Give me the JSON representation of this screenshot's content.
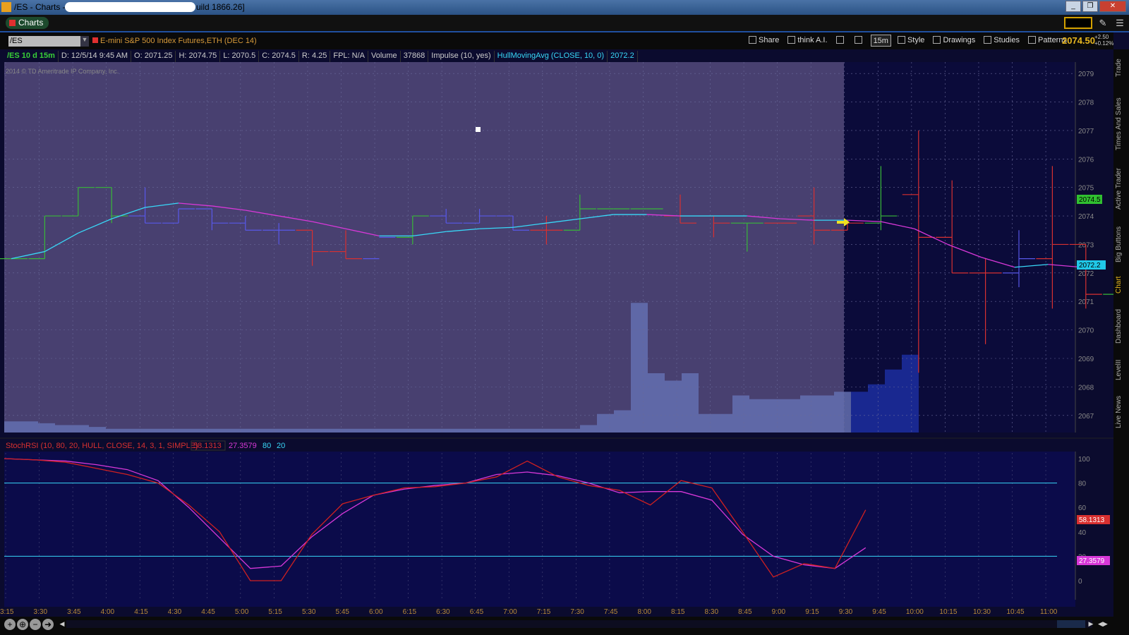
{
  "window": {
    "title": "/ES - Charts -",
    "build": "uild 1866.26]",
    "min": "_",
    "max": "❐",
    "close": "✕"
  },
  "tabbar": {
    "charts_label": "Charts",
    "pin": "✎",
    "menu": "☰"
  },
  "toolbar": {
    "symbol": "/ES",
    "dropdown": "▼",
    "description": "E-mini S&P 500 Index Futures,ETH (DEC 14)",
    "buttons": [
      {
        "label": "Share",
        "icon": "share-icon"
      },
      {
        "label": "think A.I.",
        "icon": "ai-icon"
      },
      {
        "label": "",
        "icon": "tools-icon"
      },
      {
        "label": "",
        "icon": "wrench-icon"
      },
      {
        "label": "15m",
        "icon": ""
      },
      {
        "label": "Style",
        "icon": "style-icon"
      },
      {
        "label": "Drawings",
        "icon": "pencil-icon"
      },
      {
        "label": "Studies",
        "icon": "studies-icon"
      },
      {
        "label": "Patterns",
        "icon": "patterns-icon"
      }
    ],
    "last": "2074.50",
    "chg": "+2.50",
    "pct": "+0.12%"
  },
  "infobar": {
    "ticker": "/ES 10 d 15m",
    "date": "D: 12/5/14 9:45 AM",
    "open": "O: 2071.25",
    "high": "H: 2074.75",
    "low": "L: 2070.5",
    "close": "C: 2074.5",
    "range": "R: 4.25",
    "fpl": "FPL: N/A",
    "volume_label": "Volume",
    "volume_value": "37868",
    "impulse": "Impulse (10, yes)",
    "hma": "HullMovingAvg (CLOSE, 10, 0)",
    "hma_value": "2072.2"
  },
  "copyright": "2014 © TD Ameritrade IP Company, Inc.",
  "lower": {
    "study": "StochRSI (10, 80, 20, HULL, CLOSE, 14, 3, 1, SIMPLE)",
    "k_value": "58.1313",
    "d_value": "27.3579",
    "ob": "80",
    "os": "20"
  },
  "price_tags": {
    "last": "2074.5",
    "hma": "2072.2",
    "k": "58.1313",
    "d": "27.3579"
  },
  "colors": {
    "up": "#38b838",
    "down": "#d83030",
    "flat": "#5858e8",
    "hma_up": "#38d8f8",
    "hma_down": "#d838d8",
    "bg": "#0b0b2e",
    "shade": "#484070"
  },
  "sidetabs": [
    "Trade",
    "Times And Sales",
    "Active Trader",
    "Big Buttons",
    "Chart",
    "Dashboard",
    "LevelII",
    "Live News"
  ],
  "nav": {
    "zoom_in": "+",
    "zoom_reset": "⊕",
    "zoom_out": "−",
    "forward": "➜"
  },
  "chart_data": {
    "type": "bar",
    "time_labels": [
      "3:15",
      "3:30",
      "3:45",
      "4:00",
      "4:15",
      "4:30",
      "4:45",
      "5:00",
      "5:15",
      "5:30",
      "5:45",
      "6:00",
      "6:15",
      "6:30",
      "6:45",
      "7:00",
      "7:15",
      "7:30",
      "7:45",
      "8:00",
      "8:15",
      "8:30",
      "8:45",
      "9:00",
      "9:15",
      "9:30",
      "9:45",
      "10:00",
      "10:15",
      "10:30",
      "10:45",
      "11:00"
    ],
    "price_ticks": [
      2067,
      2068,
      2069,
      2070,
      2071,
      2072,
      2073,
      2074,
      2075,
      2076,
      2077,
      2078,
      2079
    ],
    "ylim": [
      2066.4,
      2079.4
    ],
    "osc_ticks": [
      0,
      20,
      40,
      60,
      80,
      100
    ],
    "bars": [
      {
        "o": 2072.5,
        "h": 2072.5,
        "l": 2072.5,
        "c": 2072.5,
        "color": "up"
      },
      {
        "o": 2072.5,
        "h": 2074,
        "l": 2072.5,
        "c": 2074,
        "color": "up"
      },
      {
        "o": 2074,
        "h": 2075,
        "l": 2074,
        "c": 2075,
        "color": "up"
      },
      {
        "o": 2075,
        "h": 2075,
        "l": 2073.75,
        "c": 2074,
        "color": "up"
      },
      {
        "o": 2074,
        "h": 2075,
        "l": 2073.75,
        "c": 2073.75,
        "color": "flat"
      },
      {
        "o": 2073.75,
        "h": 2074.25,
        "l": 2073.75,
        "c": 2074.25,
        "color": "flat"
      },
      {
        "o": 2074.25,
        "h": 2074.25,
        "l": 2073.5,
        "c": 2073.75,
        "color": "flat"
      },
      {
        "o": 2073.75,
        "h": 2074,
        "l": 2073.5,
        "c": 2073.5,
        "color": "flat"
      },
      {
        "o": 2073.5,
        "h": 2073.75,
        "l": 2073,
        "c": 2073.5,
        "color": "flat"
      },
      {
        "o": 2073.5,
        "h": 2073.5,
        "l": 2072.25,
        "c": 2072.75,
        "color": "down"
      },
      {
        "o": 2072.75,
        "h": 2073.5,
        "l": 2072.5,
        "c": 2072.5,
        "color": "down"
      },
      {
        "o": 2072.5,
        "h": 2073.25,
        "l": 2073.25,
        "c": 2073.25,
        "color": "flat"
      },
      {
        "o": 2073.25,
        "h": 2074,
        "l": 2073,
        "c": 2074,
        "color": "up"
      },
      {
        "o": 2074,
        "h": 2074.25,
        "l": 2073.75,
        "c": 2073.75,
        "color": "flat"
      },
      {
        "o": 2073.75,
        "h": 2074.25,
        "l": 2073.75,
        "c": 2074,
        "color": "flat"
      },
      {
        "o": 2074,
        "h": 2074,
        "l": 2073.5,
        "c": 2073.5,
        "color": "flat"
      },
      {
        "o": 2073.5,
        "h": 2074,
        "l": 2073,
        "c": 2073.5,
        "color": "down"
      },
      {
        "o": 2073.5,
        "h": 2074.75,
        "l": 2073.5,
        "c": 2074.25,
        "color": "up"
      },
      {
        "o": 2074.25,
        "h": 2074.25,
        "l": 2074.25,
        "c": 2074.25,
        "color": "up"
      },
      {
        "o": 2074.25,
        "h": 2074.25,
        "l": 2074.25,
        "c": 2074.25,
        "color": "up"
      },
      {
        "o": 2074,
        "h": 2074.75,
        "l": 2073.75,
        "c": 2073.75,
        "color": "down"
      },
      {
        "o": 2074,
        "h": 2074,
        "l": 2073.25,
        "c": 2073.75,
        "color": "down"
      },
      {
        "o": 2073.75,
        "h": 2073.75,
        "l": 2072.75,
        "c": 2073.75,
        "color": "up"
      },
      {
        "o": 2073.75,
        "h": 2073.75,
        "l": 2073.75,
        "c": 2073.75,
        "color": "down"
      },
      {
        "o": 2074,
        "h": 2075,
        "l": 2073,
        "c": 2073.5,
        "color": "down"
      },
      {
        "o": 2073.5,
        "h": 2073.75,
        "l": 2073.5,
        "c": 2073.75,
        "color": "down"
      },
      {
        "o": 2073.75,
        "h": 2075.75,
        "l": 2073.5,
        "c": 2074,
        "color": "up"
      },
      {
        "o": 2074.75,
        "h": 2077,
        "l": 2068.5,
        "c": 2073.25,
        "color": "down"
      },
      {
        "o": 2073.25,
        "h": 2075.25,
        "l": 2072,
        "c": 2072,
        "color": "down"
      },
      {
        "o": 2072,
        "h": 2072.5,
        "l": 2069.5,
        "c": 2072,
        "color": "down"
      },
      {
        "o": 2072,
        "h": 2073.5,
        "l": 2071.5,
        "c": 2072.5,
        "color": "flat"
      },
      {
        "o": 2072.5,
        "h": 2075.75,
        "l": 2070.75,
        "c": 2073,
        "color": "down"
      },
      {
        "o": 2073,
        "h": 2073,
        "l": 2070.75,
        "c": 2071.25,
        "color": "down"
      },
      {
        "o": 2071.25,
        "h": 2074.75,
        "l": 2070.5,
        "c": 2074.5,
        "color": "up"
      }
    ],
    "hma": [
      2072.5,
      2072.75,
      2073.4,
      2073.9,
      2074.3,
      2074.45,
      2074.35,
      2074.2,
      2074,
      2073.8,
      2073.55,
      2073.3,
      2073.3,
      2073.45,
      2073.55,
      2073.6,
      2073.75,
      2073.9,
      2074.05,
      2074.05,
      2074,
      2074,
      2074,
      2073.9,
      2073.85,
      2073.85,
      2073.8,
      2073.55,
      2073,
      2072.55,
      2072.2,
      2072.3,
      2072.2
    ],
    "volume": [
      0.03,
      0.03,
      0.025,
      0.02,
      0.02,
      0.015,
      0.01,
      0.01,
      0.01,
      0.01,
      0.01,
      0.01,
      0.01,
      0.01,
      0.01,
      0.01,
      0.01,
      0.01,
      0.01,
      0.01,
      0.01,
      0.01,
      0.01,
      0.01,
      0.01,
      0.01,
      0.01,
      0.01,
      0.01,
      0.01,
      0.01,
      0.01,
      0.01,
      0.01,
      0.02,
      0.05,
      0.06,
      0.35,
      0.16,
      0.14,
      0.16,
      0.05,
      0.05,
      0.1,
      0.09,
      0.09,
      0.09,
      0.1,
      0.1,
      0.11,
      0.11,
      0.13,
      0.17,
      0.21,
      0.22,
      0.22
    ],
    "stoch_k": [
      100,
      99,
      97,
      92,
      87,
      80,
      62,
      40,
      0,
      0,
      38,
      63,
      70,
      76,
      77,
      80,
      85,
      98,
      85,
      78,
      74,
      62,
      82,
      76,
      40,
      3,
      14,
      10,
      58
    ],
    "stoch_d": [
      100,
      99,
      98,
      95,
      91,
      82,
      60,
      35,
      10,
      12,
      36,
      55,
      70,
      75,
      78,
      80,
      87,
      89,
      86,
      80,
      72,
      73,
      73,
      66,
      38,
      20,
      13,
      10,
      27
    ]
  }
}
